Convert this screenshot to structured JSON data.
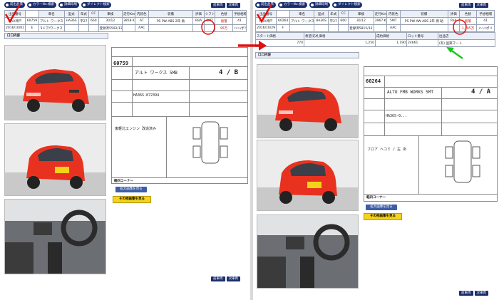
{
  "toolbar": {
    "btn1": "前出品票",
    "btn2": "カラーNo.検索",
    "btn3": "詳細印刷",
    "btn4": "ダイレクト検索"
  },
  "nav": {
    "prev": "前車両",
    "next": "次車両"
  },
  "left": {
    "headers": [
      "出品番号",
      "車名",
      "型式",
      "年式",
      "CC",
      "車検",
      "走行Km",
      "内装色",
      "装備",
      "評価",
      "シフト",
      "色替",
      "予想相場"
    ],
    "row1": [
      "HAA神戸",
      "60759",
      "アルト ワークス 5D",
      "HA36S",
      "平27",
      "660",
      "30/12",
      "3858 Km",
      "AT",
      "PS PW ABS 2年 助",
      "RBA",
      "5MT",
      "仮落",
      "41"
    ],
    "row2": [
      "2016/10/01",
      "E",
      "5ドア/ワークス",
      "",
      "",
      "",
      "登録済5592/12",
      "",
      "AAC",
      "",
      "",
      "",
      "95万",
      "ハン/ポリ"
    ],
    "section": "口口内容",
    "btn_enlarge": "拡大画像を見る",
    "btn_other": "その他画像を見る",
    "sheet": {
      "lot": "60759",
      "model": "アルト ワークス 5MB",
      "chassis": "HA36S-872394",
      "grade": "4 / B",
      "notes": "東軽北エンジン 改造済み",
      "corner": "軽四コーナー"
    }
  },
  "right": {
    "headers": [
      "出品番号",
      "車名",
      "型式",
      "年式",
      "CC",
      "車検",
      "走行Km",
      "内装色",
      "装備",
      "評価",
      "シフト",
      "色替",
      "予想相場"
    ],
    "row1": [
      "HAA神戸",
      "60264",
      "アルト ワークス 5D",
      "HA36S",
      "平27",
      "660",
      "30/12",
      "3967 Km",
      "5MT",
      "PS PW AW ABS 2年 保 助",
      "RaA",
      "仮落",
      "41"
    ],
    "row2": [
      "2016/10/29",
      "F",
      "",
      "",
      "",
      "",
      "登録済5815/12",
      "",
      "AAC",
      "",
      "",
      "1,195万",
      "ハン/ポリ"
    ],
    "sub_headers": [
      "スタート価格",
      "希望/応札価格",
      "成約価格",
      "ロット番号",
      "出品店"
    ],
    "sub_values": [
      "770",
      "1,250",
      "1,190",
      "24661",
      "(有) 国東マート"
    ],
    "section": "口口内容",
    "btn_enlarge": "拡大画像を見る",
    "btn_other": "その他画像を見る",
    "sheet": {
      "lot": "60264",
      "model": "ALTO FMB WORKS 5MT",
      "chassis": "HA36S-0...",
      "grade": "4 / A",
      "notes": "フロア ヘコミ / 左 あ",
      "corner": "軽四コーナー"
    }
  },
  "colors": {
    "accent": "#1b2f6e",
    "marker_red": "#e01010",
    "marker_green": "#18c818",
    "car_red": "#e8321f"
  }
}
